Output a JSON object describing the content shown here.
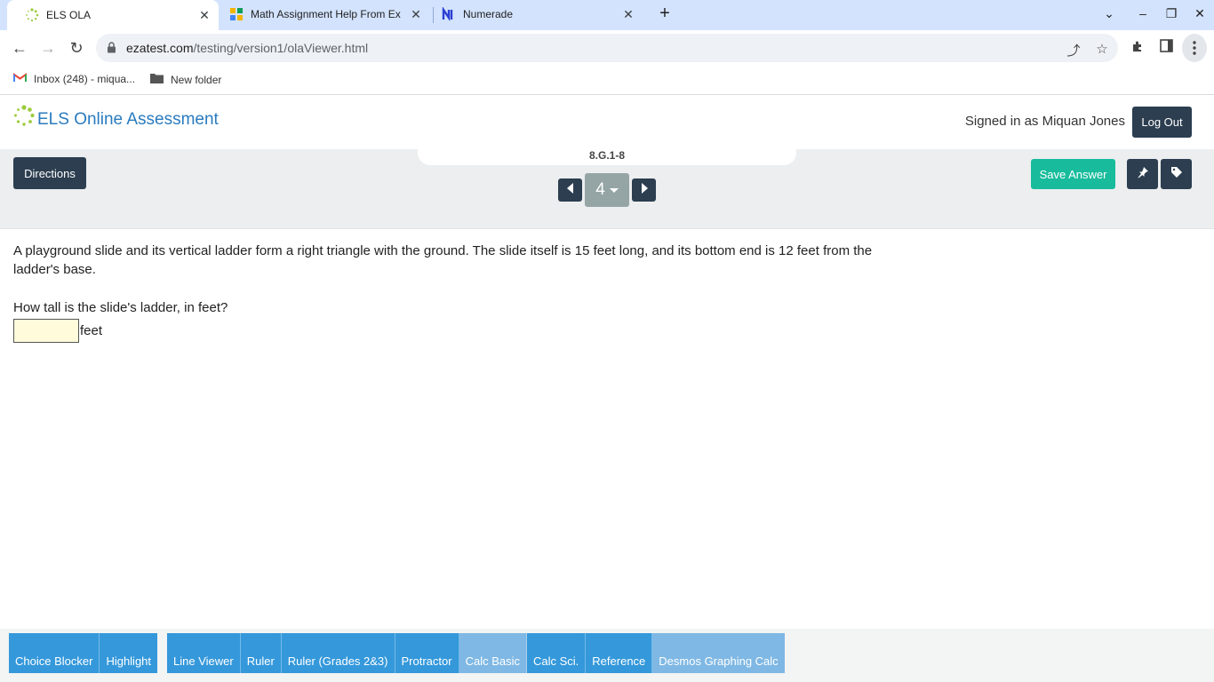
{
  "browser": {
    "tabs": [
      {
        "title": "ELS OLA",
        "active": true
      },
      {
        "title": "Math Assignment Help From Ex",
        "active": false
      },
      {
        "title": "Numerade",
        "active": false
      }
    ],
    "url_host": "ezatest.com",
    "url_path": "/testing/version1/olaViewer.html",
    "bookmarks": [
      {
        "label": "Inbox (248) - miqua..."
      },
      {
        "label": "New folder"
      }
    ]
  },
  "header": {
    "app_title": "ELS Online Assessment",
    "signed_in": "Signed in as Miquan Jones",
    "logout_label": "Log Out"
  },
  "qbar": {
    "standard": "8.G.1-8",
    "directions_label": "Directions",
    "question_number": "4",
    "save_label": "Save Answer"
  },
  "question": {
    "prompt": "A playground slide and its vertical ladder form a right triangle with the ground. The slide itself is 15 feet long, and its bottom end is 12 feet from the ladder's base.",
    "ask": "How tall is the slide's ladder, in feet?",
    "answer_value": "",
    "unit": "feet"
  },
  "tools": {
    "group1": [
      "Choice Blocker",
      "Highlight"
    ],
    "group2": [
      {
        "label": "Line Viewer",
        "light": false
      },
      {
        "label": "Ruler",
        "light": false
      },
      {
        "label": "Ruler (Grades 2&3)",
        "light": false
      },
      {
        "label": "Protractor",
        "light": false
      },
      {
        "label": "Calc Basic",
        "light": true
      },
      {
        "label": "Calc Sci.",
        "light": false
      },
      {
        "label": "Reference",
        "light": false
      },
      {
        "label": "Desmos Graphing Calc",
        "light": true
      }
    ]
  },
  "colors": {
    "dark_button": "#2c3e50",
    "save_button": "#18bc9c",
    "tool_button": "#3498db",
    "tool_button_light": "#7fb8e4",
    "answer_bg": "#fffbdb"
  }
}
